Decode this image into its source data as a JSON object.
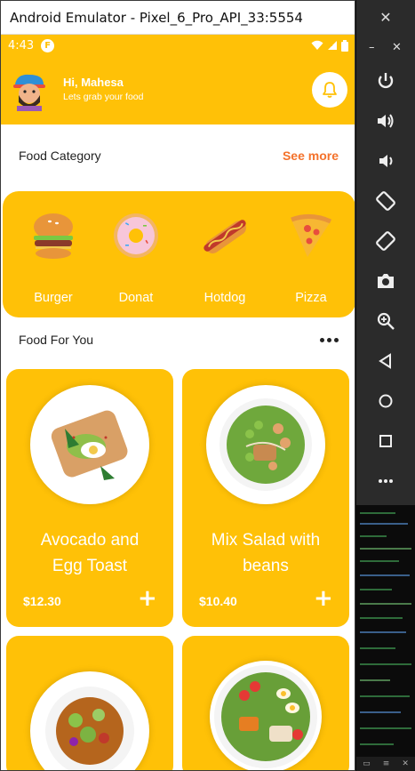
{
  "window": {
    "title": "Android Emulator - Pixel_6_Pro_API_33:5554",
    "close_glyph": "✕"
  },
  "statusbar": {
    "time": "4:43",
    "badge": "F"
  },
  "header": {
    "greeting": "Hi, Mahesa",
    "subtitle": "Lets grab your food"
  },
  "category_section": {
    "title": "Food Category",
    "see_more": "See more"
  },
  "categories": [
    {
      "label": "Burger",
      "icon": "burger-icon"
    },
    {
      "label": "Donat",
      "icon": "donut-icon"
    },
    {
      "label": "Hotdog",
      "icon": "hotdog-icon"
    },
    {
      "label": "Pizza",
      "icon": "pizza-icon"
    }
  ],
  "foryou_section": {
    "title": "Food For You"
  },
  "cards": [
    {
      "title_line1": "Avocado and",
      "title_line2": "Egg Toast",
      "price": "$12.30",
      "plus": "+"
    },
    {
      "title_line1": "Mix Salad with",
      "title_line2": "beans",
      "price": "$10.40",
      "plus": "+"
    },
    {
      "title_line1": "",
      "title_line2": "",
      "price": "",
      "plus": ""
    },
    {
      "title_line1": "",
      "title_line2": "",
      "price": "",
      "plus": ""
    }
  ],
  "emulator_controls": {
    "minimize": "–",
    "close": "✕",
    "buttons": [
      "power-icon",
      "volume-up-icon",
      "volume-down-icon",
      "rotate-left-icon",
      "rotate-right-icon",
      "camera-icon",
      "zoom-icon",
      "back-icon",
      "home-icon",
      "overview-icon",
      "more-icon"
    ]
  },
  "colors": {
    "primary": "#FFC107",
    "accent": "#F4722B",
    "sidebar": "#2b2b2b"
  }
}
